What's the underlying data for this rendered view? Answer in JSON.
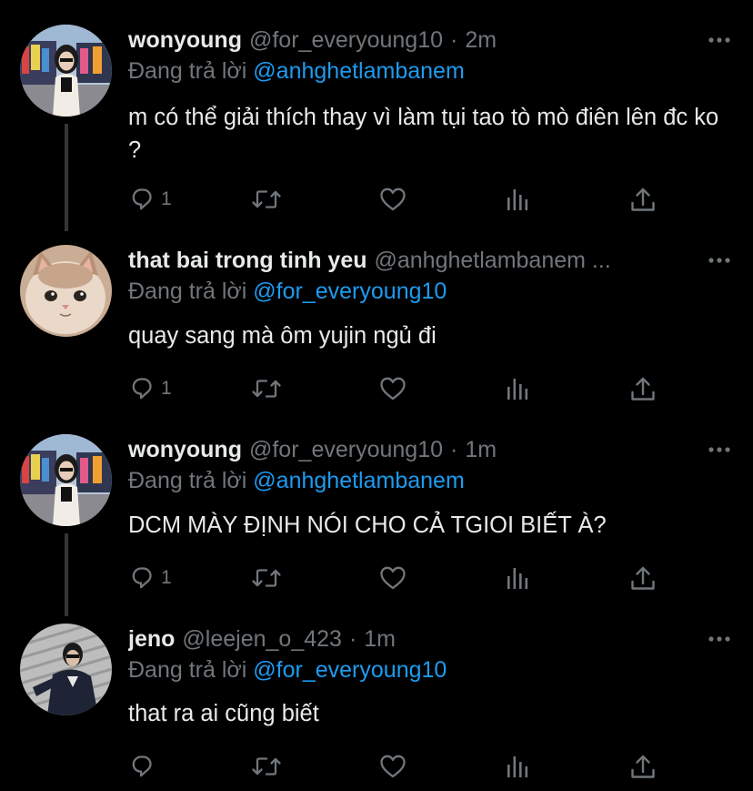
{
  "colors": {
    "background": "#000000",
    "text": "#e7e9ea",
    "secondary": "#71767b",
    "link": "#1d9bf0",
    "thread_line": "#333639"
  },
  "reply_prefix": "Đang trả lời",
  "tweets": [
    {
      "name": "wonyoung",
      "handle": "@for_everyoung10",
      "dot": "·",
      "time": "2m",
      "reply_to": "@anhghetlambanem",
      "text": "m có thể giải thích thay vì làm tụi tao tò mò điên lên đc ko ?",
      "reply_count": "1",
      "avatar": "wonyoung-avatar"
    },
    {
      "name": "that bai trong tinh yeu",
      "handle": "@anhghetlambanem ...",
      "dot": "",
      "time": "",
      "reply_to": "@for_everyoung10",
      "text": "quay sang mà ôm yujin ngủ đi",
      "reply_count": "1",
      "avatar": "kitten-avatar"
    },
    {
      "name": "wonyoung",
      "handle": "@for_everyoung10",
      "dot": "·",
      "time": "1m",
      "reply_to": "@anhghetlambanem",
      "text": "DCM MÀY ĐỊNH NÓI CHO CẢ TGIOI BIẾT À?",
      "reply_count": "1",
      "avatar": "wonyoung-avatar"
    },
    {
      "name": "jeno",
      "handle": "@leejen_o_423",
      "dot": "·",
      "time": "1m",
      "reply_to": "@for_everyoung10",
      "text": "that ra ai cũng biết",
      "reply_count": "",
      "avatar": "jeno-avatar"
    }
  ],
  "icons": {
    "reply": "reply-icon",
    "retweet": "retweet-icon",
    "like": "heart-icon",
    "analytics": "analytics-icon",
    "share": "share-icon",
    "more": "more-icon"
  }
}
